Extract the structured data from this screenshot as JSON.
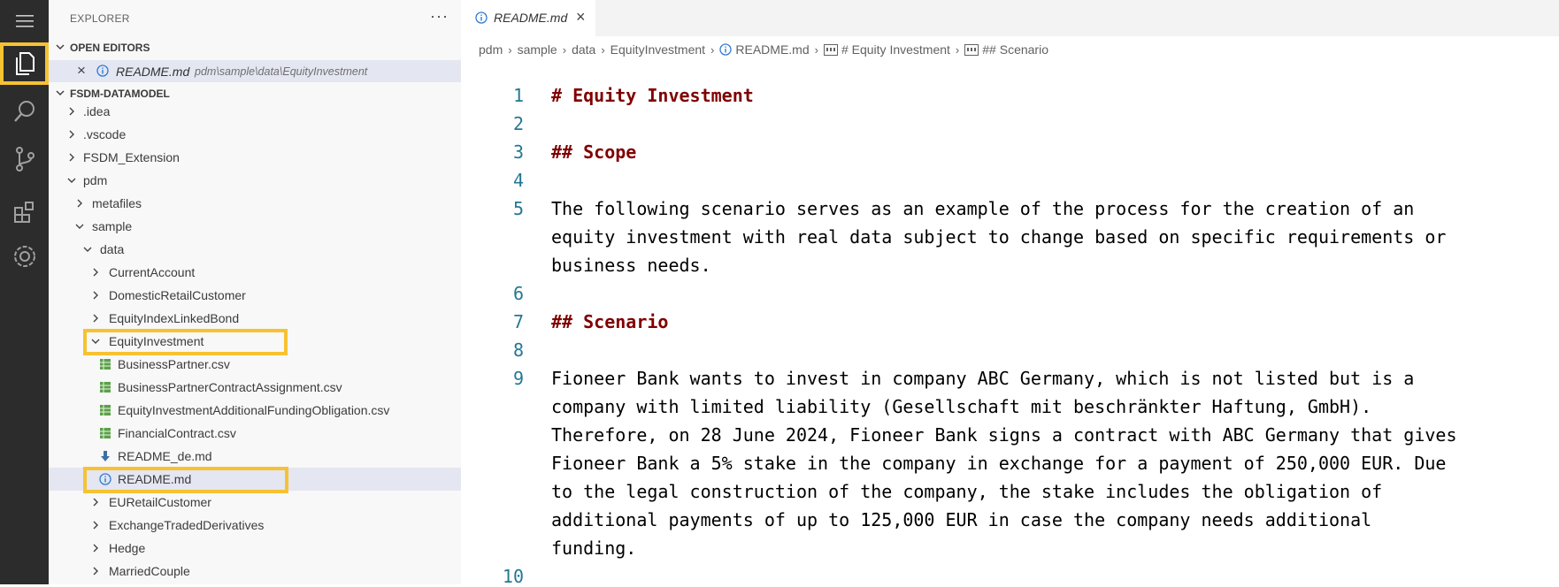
{
  "activity_bar": {
    "items": [
      "menu-icon",
      "explorer-icon",
      "search-icon",
      "source-control-icon",
      "extensions-icon",
      "settings-gear-icon"
    ]
  },
  "sidebar": {
    "title": "EXPLORER",
    "more": "···",
    "open_editors": {
      "label": "OPEN EDITORS",
      "file_name": "README.md",
      "file_path": "pdm\\sample\\data\\EquityInvestment"
    },
    "workspace": {
      "label": "FSDM-DATAMODEL",
      "items": [
        {
          "label": ".idea"
        },
        {
          "label": ".vscode"
        },
        {
          "label": "FSDM_Extension"
        },
        {
          "label": "pdm"
        },
        {
          "label": "metafiles"
        },
        {
          "label": "sample"
        },
        {
          "label": "data"
        },
        {
          "label": "CurrentAccount"
        },
        {
          "label": "DomesticRetailCustomer"
        },
        {
          "label": "EquityIndexLinkedBond"
        },
        {
          "label": "EquityInvestment"
        },
        {
          "label": "BusinessPartner.csv"
        },
        {
          "label": "BusinessPartnerContractAssignment.csv"
        },
        {
          "label": "EquityInvestmentAdditionalFundingObligation.csv"
        },
        {
          "label": "FinancialContract.csv"
        },
        {
          "label": "README_de.md"
        },
        {
          "label": "README.md"
        },
        {
          "label": "EURetailCustomer"
        },
        {
          "label": "ExchangeTradedDerivatives"
        },
        {
          "label": "Hedge"
        },
        {
          "label": "MarriedCouple"
        }
      ]
    }
  },
  "editor": {
    "tab": {
      "label": "README.md"
    },
    "breadcrumbs": [
      "pdm",
      "sample",
      "data",
      "EquityInvestment",
      "README.md",
      "# Equity Investment",
      "## Scenario"
    ],
    "line_numbers": [
      "1",
      "2",
      "3",
      "4",
      "5",
      "6",
      "7",
      "8",
      "9",
      "10"
    ],
    "lines": [
      "# Equity Investment",
      "",
      "## Scope",
      "",
      "The following scenario serves as an example of the process for the creation of an",
      "equity investment with real data subject to change based on specific requirements or",
      "business needs.",
      "",
      "## Scenario",
      "",
      "Fioneer Bank wants to invest in company ABC Germany, which is not listed but is a",
      "company with limited liability (Gesellschaft mit beschränkter Haftung, GmbH).",
      "Therefore, on 28 June 2024, Fioneer Bank signs a contract with ABC Germany that gives",
      "Fioneer Bank a 5% stake in the company in exchange for a payment of 250,000 EUR. Due",
      "to the legal construction of the company, the stake includes the obligation of",
      "additional payments of up to 125,000 EUR in case the company needs additional",
      "funding.",
      ""
    ]
  },
  "colors": {
    "activity_bar": "#2c2c2c",
    "highlight": "#f7c232",
    "heading": "#800000",
    "line_number": "#237893",
    "selection": "#e4e6f1"
  }
}
